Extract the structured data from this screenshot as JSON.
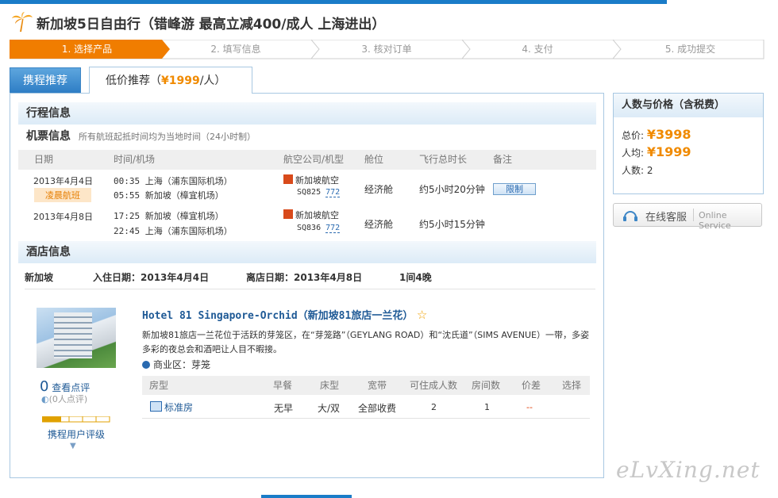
{
  "page_title": "新加坡5日自由行（错峰游 最高立减400/成人 上海进出）",
  "steps": [
    "1. 选择产品",
    "2. 填写信息",
    "3. 核对订单",
    "4. 支付",
    "5. 成功提交"
  ],
  "tabs": {
    "tab1": "携程推荐",
    "tab2_prefix": "低价推荐（",
    "tab2_price": "¥1999",
    "tab2_suffix": "/人）"
  },
  "itinerary": {
    "heading": "行程信息",
    "flight_title": "机票信息",
    "flight_note": "所有航班起抵时间均为当地时间（24小时制）",
    "columns": [
      "日期",
      "时间/机场",
      "航空公司/机型",
      "舱位",
      "飞行总时长",
      "备注"
    ],
    "flights": [
      {
        "date": "2013年4月4日",
        "tag": "凌晨航班",
        "dep": "00:35 上海（浦东国际机场）",
        "arr": "05:55 新加坡（樟宜机场）",
        "airline": "新加坡航空",
        "flight_no": "SQ825",
        "aircraft": "772",
        "cabin": "经济舱",
        "duration": "约5小时20分钟",
        "remark": "限制"
      },
      {
        "date": "2013年4月8日",
        "tag": "",
        "dep": "17:25 新加坡（樟宜机场）",
        "arr": "22:45 上海（浦东国际机场）",
        "airline": "新加坡航空",
        "flight_no": "SQ836",
        "aircraft": "772",
        "cabin": "经济舱",
        "duration": "约5小时15分钟",
        "remark": ""
      }
    ]
  },
  "hotel": {
    "heading": "酒店信息",
    "city": "新加坡",
    "checkin": "入住日期：2013年4月4日",
    "checkout": "离店日期：2013年4月8日",
    "nights": "1间4晚",
    "name": "Hotel 81 Singapore-Orchid（新加坡81旅店一兰花）",
    "star": "☆",
    "description": "新加坡81旅店一兰花位于活跃的芽笼区，在“芽笼路”（GEYLANG ROAD）和“沈氏道”（SIMS AVENUE）一带，多姿多彩的夜总会和酒吧让人目不暇接。",
    "business_area": "商业区：芽笼",
    "review_count": "0",
    "review_link": "查看点评",
    "review_people": "(0人点评)",
    "rating_label": "携程用户评级",
    "room_columns": [
      "房型",
      "早餐",
      "床型",
      "宽带",
      "可住成人数",
      "房间数",
      "价差",
      "选择"
    ],
    "rooms": [
      {
        "type": "标准房",
        "breakfast": "无早",
        "bed": "大/双",
        "internet": "全部收费",
        "adults": "2",
        "count": "1",
        "diff": "--"
      }
    ]
  },
  "sidebar": {
    "heading": "人数与价格（含税费）",
    "total_label": "总价:",
    "total": "¥3998",
    "avg_label": "人均:",
    "avg": "¥1999",
    "people_label": "人数:",
    "people": "2",
    "service_cn": "在线客服",
    "service_en": "Online Service"
  },
  "watermark": "eLvXing.net",
  "colors": {
    "accent_orange": "#f08a00",
    "brand_blue": "#1a7cc8",
    "step_active": "#f07d00"
  }
}
